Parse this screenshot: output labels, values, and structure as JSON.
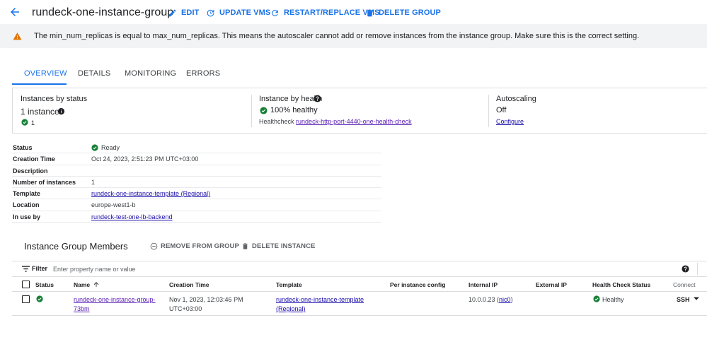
{
  "header": {
    "title": "rundeck-one-instance-group",
    "edit_label": "EDIT",
    "update_vms_label": "UPDATE VMS",
    "restart_replace_label": "RESTART/REPLACE VMS",
    "delete_group_label": "DELETE GROUP"
  },
  "warning": {
    "text": "The min_num_replicas is equal to max_num_replicas. This means the autoscaler cannot add or remove instances from the instance group. Make sure this is the correct setting."
  },
  "tabs": [
    {
      "label": "OVERVIEW",
      "active": true
    },
    {
      "label": "DETAILS",
      "active": false
    },
    {
      "label": "MONITORING",
      "active": false
    },
    {
      "label": "ERRORS",
      "active": false
    }
  ],
  "status_panel": {
    "instances_by_status": {
      "title": "Instances by status",
      "count_label": "1 instance",
      "ok_count": "1"
    },
    "instance_by_health": {
      "title": "Instance by health",
      "healthy_label": "100% healthy",
      "healthcheck_prefix": "Healthcheck",
      "healthcheck_link": "rundeck-http-port-4440-one-health-check"
    },
    "autoscaling": {
      "title": "Autoscaling",
      "value": "Off",
      "configure_link": "Configure"
    }
  },
  "details": [
    {
      "key": "Status",
      "value": "Ready"
    },
    {
      "key": "Creation Time",
      "value": "Oct 24, 2023, 2:51:23 PM UTC+03:00"
    },
    {
      "key": "Description",
      "value": ""
    },
    {
      "key": "Number of instances",
      "value": "1"
    },
    {
      "key": "Template",
      "value": "rundeck-one-instance-template (Regional)"
    },
    {
      "key": "Location",
      "value": "europe-west1-b"
    },
    {
      "key": "In use by",
      "value": "rundeck-test-one-lb-backend"
    }
  ],
  "members": {
    "title": "Instance Group Members",
    "remove_label": "REMOVE FROM GROUP",
    "delete_instance_label": "DELETE INSTANCE",
    "filter_label": "Filter",
    "filter_placeholder": "Enter property name or value",
    "columns": {
      "status": "Status",
      "name": "Name",
      "creation_time": "Creation Time",
      "template": "Template",
      "per_instance_config": "Per instance config",
      "internal_ip": "Internal IP",
      "external_ip": "External IP",
      "health_check_status": "Health Check Status",
      "connect": "Connect"
    },
    "rows": [
      {
        "name_line1": "rundeck-one-instance-group-",
        "name_line2": "73bm",
        "creation_line1": "Nov 1, 2023, 12:03:46 PM",
        "creation_line2": "UTC+03:00",
        "template_line1": "rundeck-one-instance-template",
        "template_line2": "(Regional)",
        "internal_ip": "10.0.0.23",
        "nic": "nic0",
        "health": "Healthy",
        "connect": "SSH"
      }
    ]
  },
  "colors": {
    "accent": "#1a73e8",
    "success": "#188038",
    "warning": "#e37400"
  }
}
